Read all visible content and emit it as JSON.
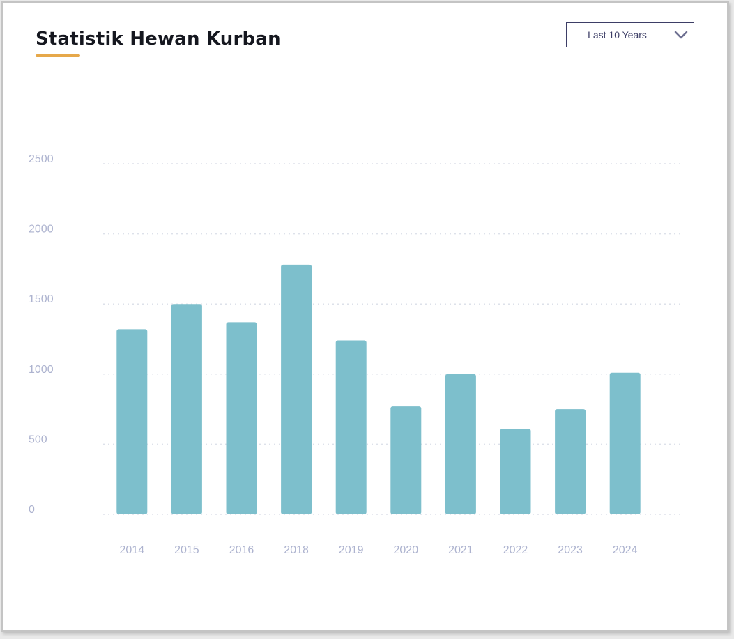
{
  "header": {
    "title": "Statistik Hewan Kurban",
    "range_select": {
      "selected": "Last 10 Years"
    }
  },
  "colors": {
    "bar": "#7dbfcc",
    "accent": "#e6a84a",
    "axis_text": "#adb3cf",
    "grid": "#dde1ea",
    "title": "#15171f"
  },
  "icons": {
    "dropdown": "chevron-down-icon"
  },
  "chart_data": {
    "type": "bar",
    "title": "Statistik Hewan Kurban",
    "xlabel": "",
    "ylabel": "",
    "categories": [
      "2014",
      "2015",
      "2016",
      "2018",
      "2019",
      "2020",
      "2021",
      "2022",
      "2023",
      "2024"
    ],
    "values": [
      1320,
      1500,
      1370,
      1780,
      1240,
      770,
      1000,
      610,
      750,
      1010
    ],
    "ylim": [
      0,
      2500
    ],
    "yticks": [
      0,
      500,
      1000,
      1500,
      2000,
      2500
    ],
    "grid": true,
    "legend": "none"
  }
}
